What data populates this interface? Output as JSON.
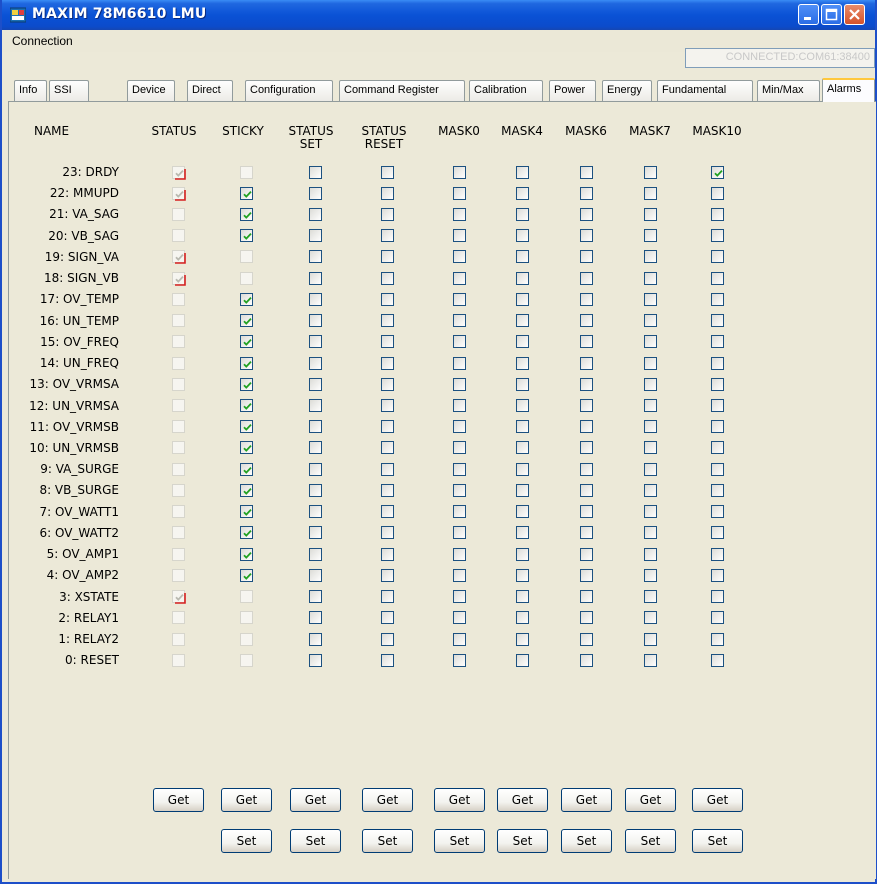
{
  "window": {
    "title": "MAXIM 78M6610 LMU",
    "status_text": "CONNECTED:COM61:38400"
  },
  "menu": [
    "Connection"
  ],
  "tabs": [
    "Info",
    "SSI",
    "Device",
    "Direct",
    "Configuration",
    "Command Register",
    "Calibration",
    "Power",
    "Energy",
    "Fundamental",
    "Min/Max",
    "Alarms"
  ],
  "active_tab": "Alarms",
  "columns": [
    {
      "key": "status",
      "label1": "STATUS",
      "label2": ""
    },
    {
      "key": "sticky",
      "label1": "STICKY",
      "label2": ""
    },
    {
      "key": "status_set",
      "label1": "STATUS",
      "label2": "SET"
    },
    {
      "key": "status_reset",
      "label1": "STATUS",
      "label2": "RESET"
    },
    {
      "key": "mask0",
      "label1": "MASK0",
      "label2": ""
    },
    {
      "key": "mask4",
      "label1": "MASK4",
      "label2": ""
    },
    {
      "key": "mask6",
      "label1": "MASK6",
      "label2": ""
    },
    {
      "key": "mask7",
      "label1": "MASK7",
      "label2": ""
    },
    {
      "key": "mask10",
      "label1": "MASK10",
      "label2": ""
    }
  ],
  "name_header": "NAME",
  "rows": [
    {
      "name": "23: DRDY",
      "status": true,
      "sticky": false,
      "mask10": true
    },
    {
      "name": "22: MMUPD",
      "status": true,
      "sticky": true,
      "mask10": false
    },
    {
      "name": "21: VA_SAG",
      "status": false,
      "sticky": true,
      "mask10": false
    },
    {
      "name": "20: VB_SAG",
      "status": false,
      "sticky": true,
      "mask10": false
    },
    {
      "name": "19: SIGN_VA",
      "status": true,
      "sticky": false,
      "mask10": false
    },
    {
      "name": "18: SIGN_VB",
      "status": true,
      "sticky": false,
      "mask10": false
    },
    {
      "name": "17: OV_TEMP",
      "status": false,
      "sticky": true,
      "mask10": false
    },
    {
      "name": "16: UN_TEMP",
      "status": false,
      "sticky": true,
      "mask10": false
    },
    {
      "name": "15: OV_FREQ",
      "status": false,
      "sticky": true,
      "mask10": false
    },
    {
      "name": "14: UN_FREQ",
      "status": false,
      "sticky": true,
      "mask10": false
    },
    {
      "name": "13: OV_VRMSA",
      "status": false,
      "sticky": true,
      "mask10": false
    },
    {
      "name": "12: UN_VRMSA",
      "status": false,
      "sticky": true,
      "mask10": false
    },
    {
      "name": "11: OV_VRMSB",
      "status": false,
      "sticky": true,
      "mask10": false
    },
    {
      "name": "10: UN_VRMSB",
      "status": false,
      "sticky": true,
      "mask10": false
    },
    {
      "name": "9: VA_SURGE",
      "status": false,
      "sticky": true,
      "mask10": false
    },
    {
      "name": "8: VB_SURGE",
      "status": false,
      "sticky": true,
      "mask10": false
    },
    {
      "name": "7: OV_WATT1",
      "status": false,
      "sticky": true,
      "mask10": false
    },
    {
      "name": "6: OV_WATT2",
      "status": false,
      "sticky": true,
      "mask10": false
    },
    {
      "name": "5: OV_AMP1",
      "status": false,
      "sticky": true,
      "mask10": false
    },
    {
      "name": "4: OV_AMP2",
      "status": false,
      "sticky": true,
      "mask10": false
    },
    {
      "name": "3: XSTATE",
      "status": true,
      "sticky": false,
      "mask10": false
    },
    {
      "name": "2: RELAY1",
      "status": false,
      "sticky": false,
      "mask10": false
    },
    {
      "name": "1: RELAY2",
      "status": false,
      "sticky": false,
      "mask10": false
    },
    {
      "name": "0: RESET",
      "status": false,
      "sticky": false,
      "mask10": false
    }
  ],
  "buttons": {
    "get": "Get",
    "set": "Set"
  },
  "colors": {
    "title_bar": "#0a52d6",
    "status_check": "#d62020",
    "normal_check": "#21a121"
  }
}
